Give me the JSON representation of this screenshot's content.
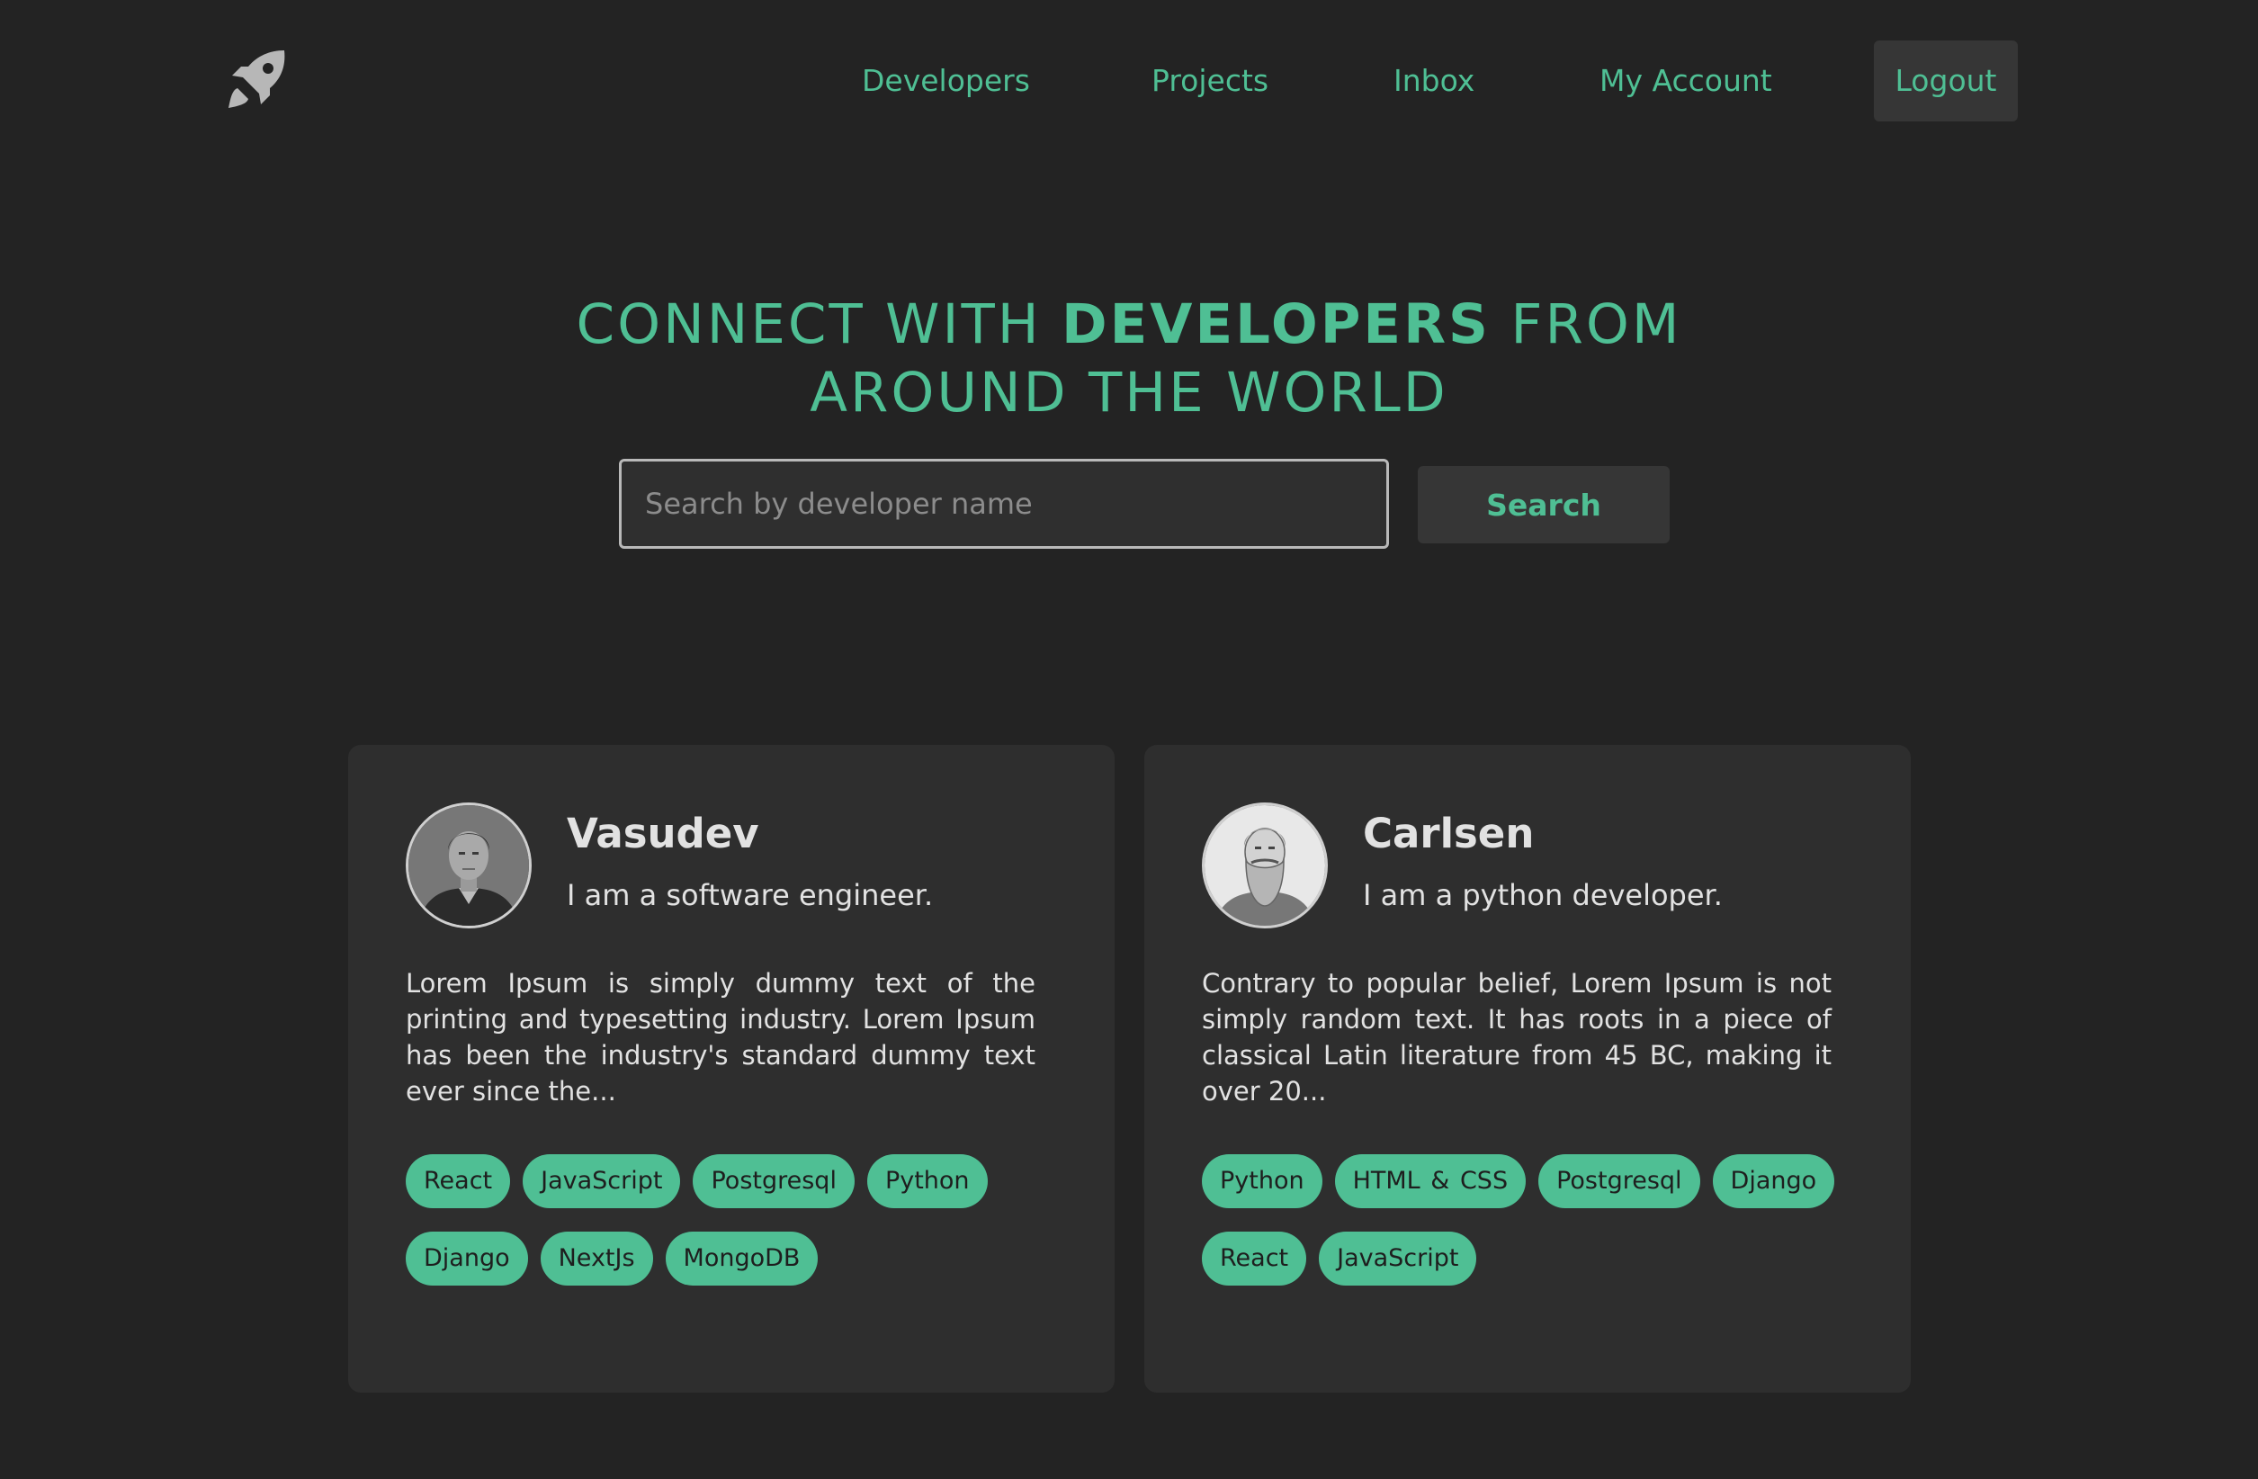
{
  "brand": {
    "logo_icon": "rocket-icon",
    "accent_color": "#4fbf94"
  },
  "nav": {
    "developers": "Developers",
    "projects": "Projects",
    "inbox": "Inbox",
    "account": "My Account",
    "logout": "Logout"
  },
  "hero": {
    "title_part1": "CONNECT WITH ",
    "title_bold": "DEVELOPERS",
    "title_part2": " FROM",
    "title_line2": "AROUND THE WORLD"
  },
  "search": {
    "placeholder": "Search by developer name",
    "value": "",
    "button_label": "Search"
  },
  "developers": [
    {
      "name": "Vasudev",
      "role": "I am a software engineer.",
      "bio": "Lorem Ipsum is simply dummy text of the printing and typesetting industry. Lorem Ipsum has been the industry's standard dummy text ever since the...",
      "tags": [
        "React",
        "JavaScript",
        "Postgresql",
        "Python",
        "Django",
        "NextJs",
        "MongoDB"
      ]
    },
    {
      "name": "Carlsen",
      "role": "I am a python developer.",
      "bio": "Contrary to popular belief, Lorem Ipsum is not simply random text. It has roots in a piece of classical Latin literature from 45 BC, making it over 20...",
      "tags": [
        "Python",
        "HTML & CSS",
        "Postgresql",
        "Django",
        "React",
        "JavaScript"
      ]
    }
  ]
}
